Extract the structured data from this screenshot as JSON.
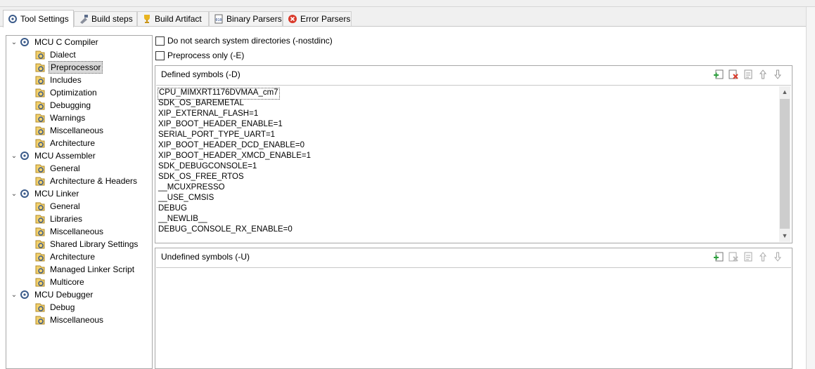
{
  "tabs": [
    {
      "label": "Tool Settings",
      "icon": "tool-settings-icon",
      "active": true
    },
    {
      "label": "Build steps",
      "icon": "build-steps-icon"
    },
    {
      "label": "Build Artifact",
      "icon": "trophy-icon"
    },
    {
      "label": "Binary Parsers",
      "icon": "binary-icon"
    },
    {
      "label": "Error Parsers",
      "icon": "error-icon"
    }
  ],
  "tree": {
    "groups": [
      {
        "label": "MCU C Compiler",
        "children": [
          "Dialect",
          "Preprocessor",
          "Includes",
          "Optimization",
          "Debugging",
          "Warnings",
          "Miscellaneous",
          "Architecture"
        ]
      },
      {
        "label": "MCU Assembler",
        "children": [
          "General",
          "Architecture & Headers"
        ]
      },
      {
        "label": "MCU Linker",
        "children": [
          "General",
          "Libraries",
          "Miscellaneous",
          "Shared Library Settings",
          "Architecture",
          "Managed Linker Script",
          "Multicore"
        ]
      },
      {
        "label": "MCU Debugger",
        "children": [
          "Debug",
          "Miscellaneous"
        ]
      }
    ],
    "selected": "Preprocessor"
  },
  "options": {
    "nostdinc_label": "Do not search system directories (-nostdinc)",
    "preprocess_only_label": "Preprocess only (-E)"
  },
  "defined": {
    "title": "Defined symbols (-D)",
    "symbols": [
      "CPU_MIMXRT1176DVMAA_cm7",
      "SDK_OS_BAREMETAL",
      "XIP_EXTERNAL_FLASH=1",
      "XIP_BOOT_HEADER_ENABLE=1",
      "SERIAL_PORT_TYPE_UART=1",
      "XIP_BOOT_HEADER_DCD_ENABLE=0",
      "XIP_BOOT_HEADER_XMCD_ENABLE=1",
      "SDK_DEBUGCONSOLE=1",
      "SDK_OS_FREE_RTOS",
      "__MCUXPRESSO",
      "__USE_CMSIS",
      "DEBUG",
      "__NEWLIB__",
      "DEBUG_CONSOLE_RX_ENABLE=0"
    ]
  },
  "undefined": {
    "title": "Undefined symbols (-U)",
    "symbols": []
  },
  "toolbar_icons": [
    "add-icon",
    "delete-icon",
    "edit-icon",
    "move-up-icon",
    "move-down-icon"
  ],
  "colors": {
    "selection": "#d9d9d9",
    "border": "#a8a8a8",
    "add": "#2e9e3e",
    "delete": "#d93a2b"
  }
}
